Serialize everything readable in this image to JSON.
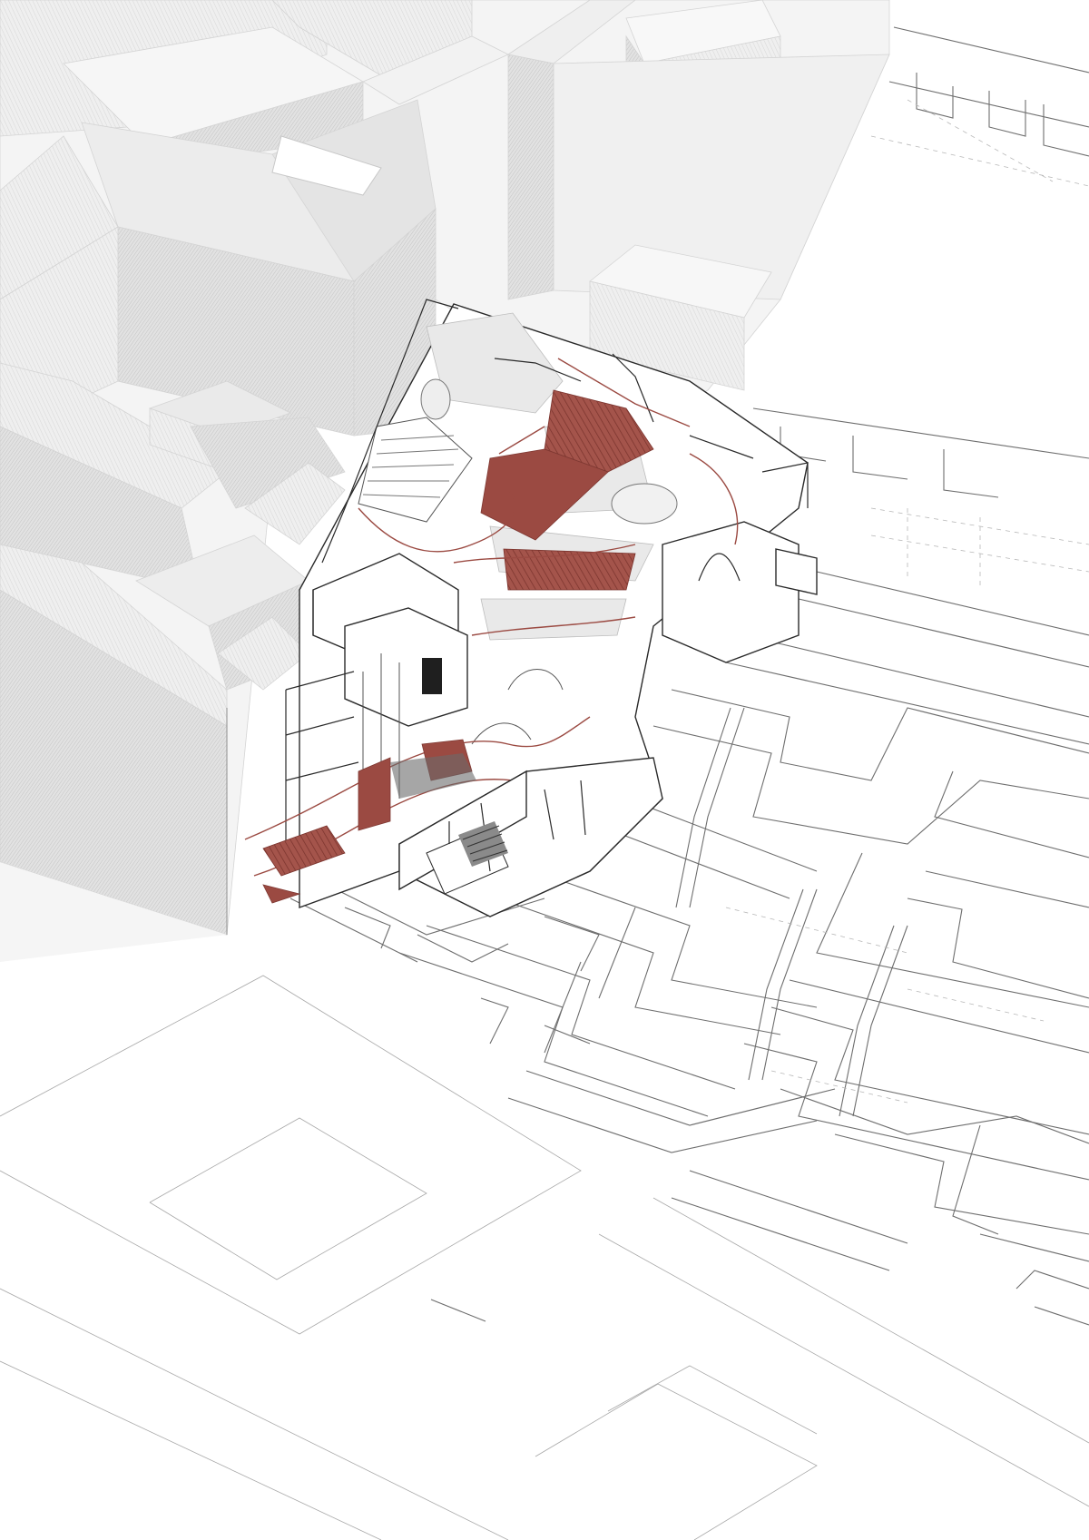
{
  "colors": {
    "background": "#ffffff",
    "context_mass_light": "#ececec",
    "context_mass_mid": "#dedede",
    "context_mass_dark": "#cfcfcf",
    "plan_line": "#6e6e6e",
    "section_cut": "#2a2a2a",
    "accent_red": "#9b4a42"
  }
}
